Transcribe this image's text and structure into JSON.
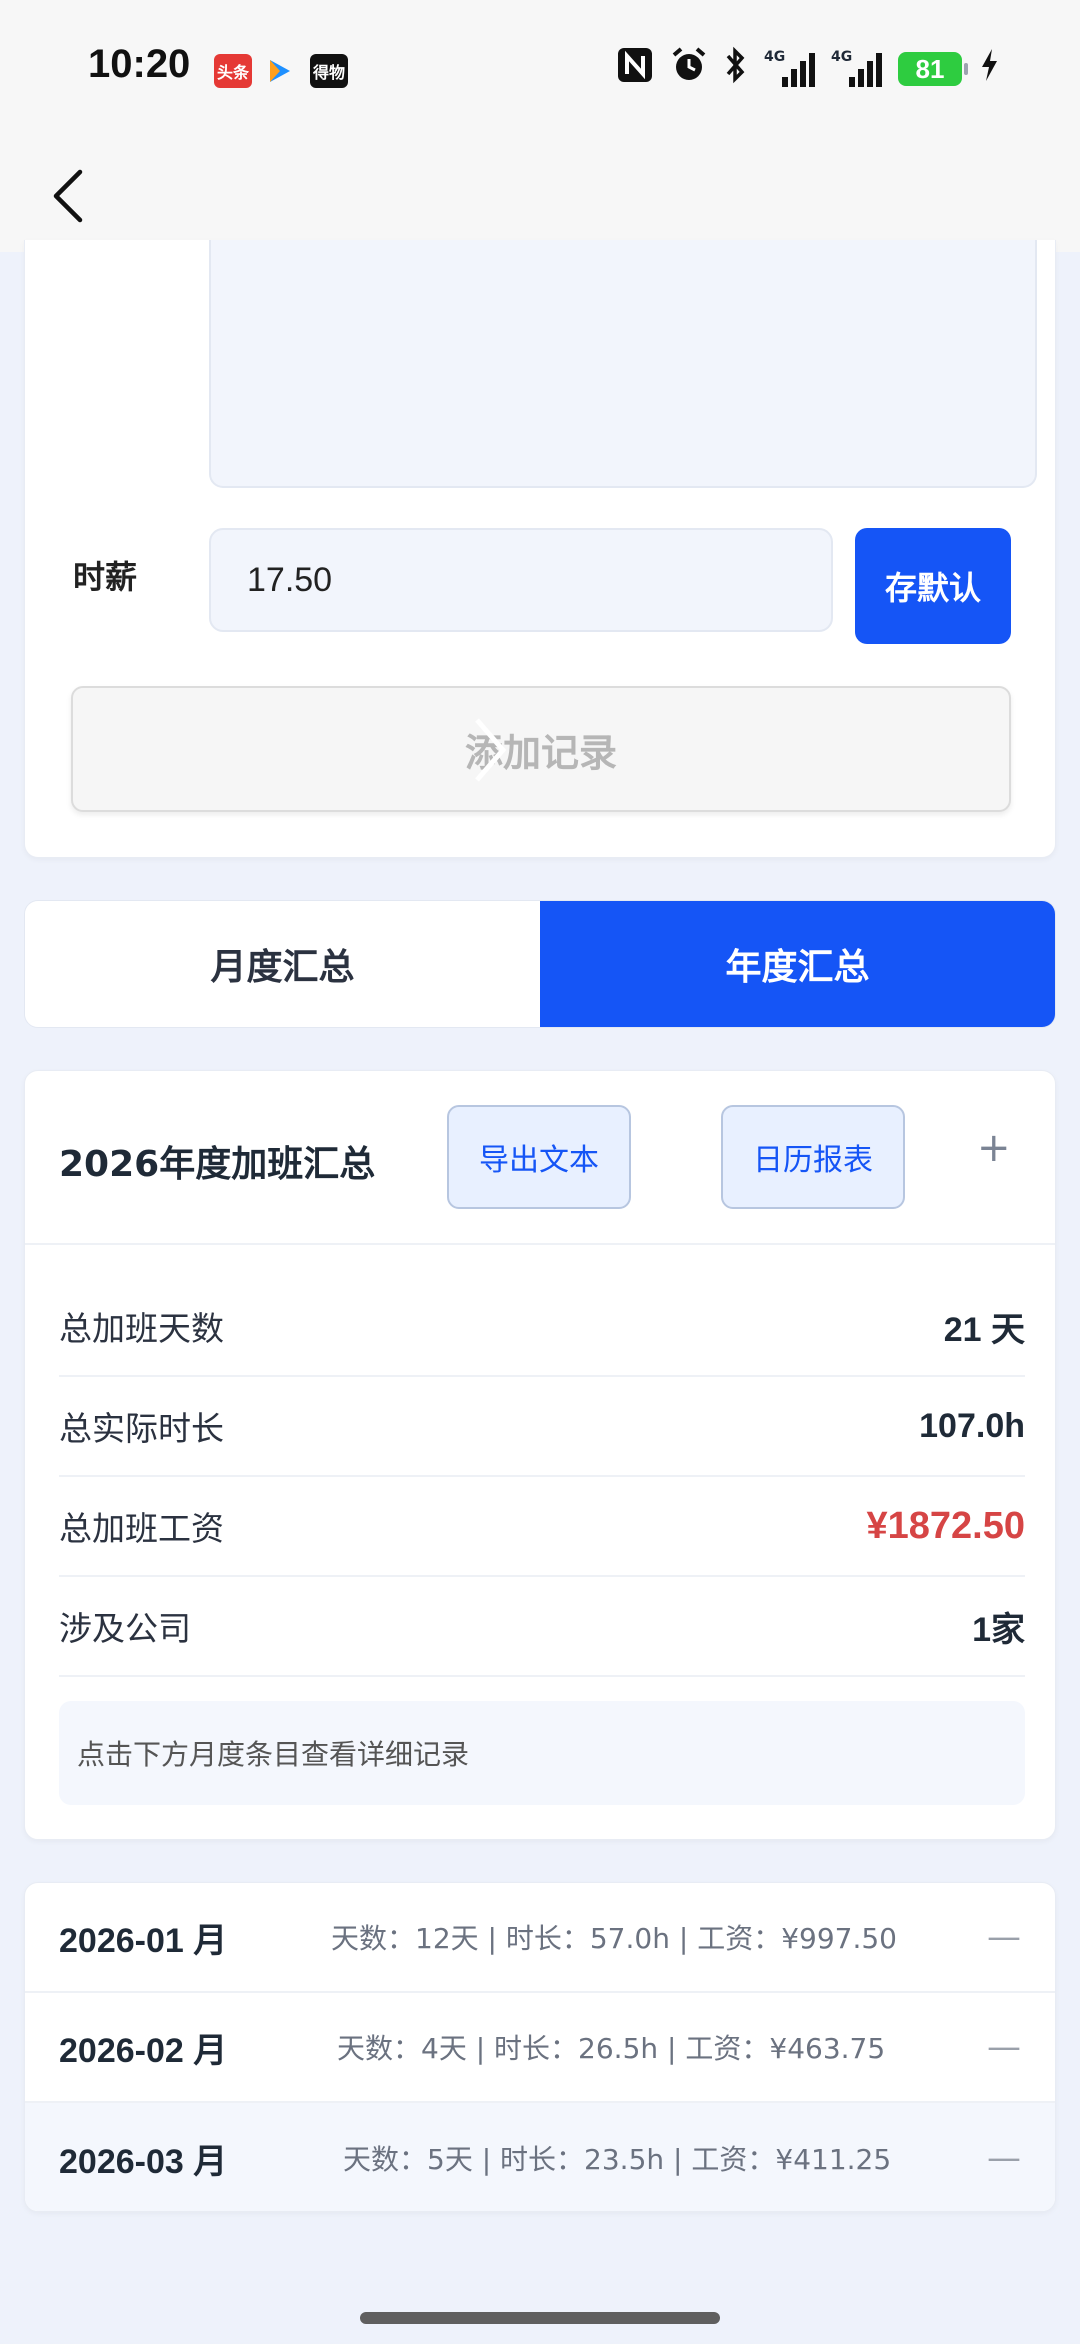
{
  "status_bar": {
    "time": "10:20",
    "apps": [
      "头条",
      "",
      "得物"
    ],
    "network_labels": [
      "4G",
      "4G"
    ],
    "battery": "81"
  },
  "form": {
    "wage_label": "时薪",
    "wage_value": "17.50",
    "save_default_label": "存默认",
    "add_record_label": "添加记录"
  },
  "tabs": [
    {
      "label": "月度汇总",
      "active": false
    },
    {
      "label": "年度汇总",
      "active": true
    }
  ],
  "summary": {
    "title": "2026年度加班汇总",
    "export_label": "导出文本",
    "calendar_label": "日历报表",
    "plus_label": "+",
    "stats": [
      {
        "label": "总加班天数",
        "value": "21 天"
      },
      {
        "label": "总实际时长",
        "value": "107.0h"
      },
      {
        "label": "总加班工资",
        "value": "¥1872.50"
      },
      {
        "label": "涉及公司",
        "value": "1家"
      }
    ],
    "hint": "点击下方月度条目查看详细记录"
  },
  "months": [
    {
      "title": "2026-01 月",
      "detail": "天数：12天 | 时长：57.0h | 工资：¥997.50",
      "toggle": "—"
    },
    {
      "title": "2026-02 月",
      "detail": "天数：4天 | 时长：26.5h | 工资：¥463.75",
      "toggle": "—"
    },
    {
      "title": "2026-03 月",
      "detail": "天数：5天 | 时长：23.5h | 工资：¥411.25",
      "toggle": "—"
    }
  ],
  "colors": {
    "accent": "#1555f6",
    "money": "#d64545",
    "background": "#eef2fb"
  }
}
